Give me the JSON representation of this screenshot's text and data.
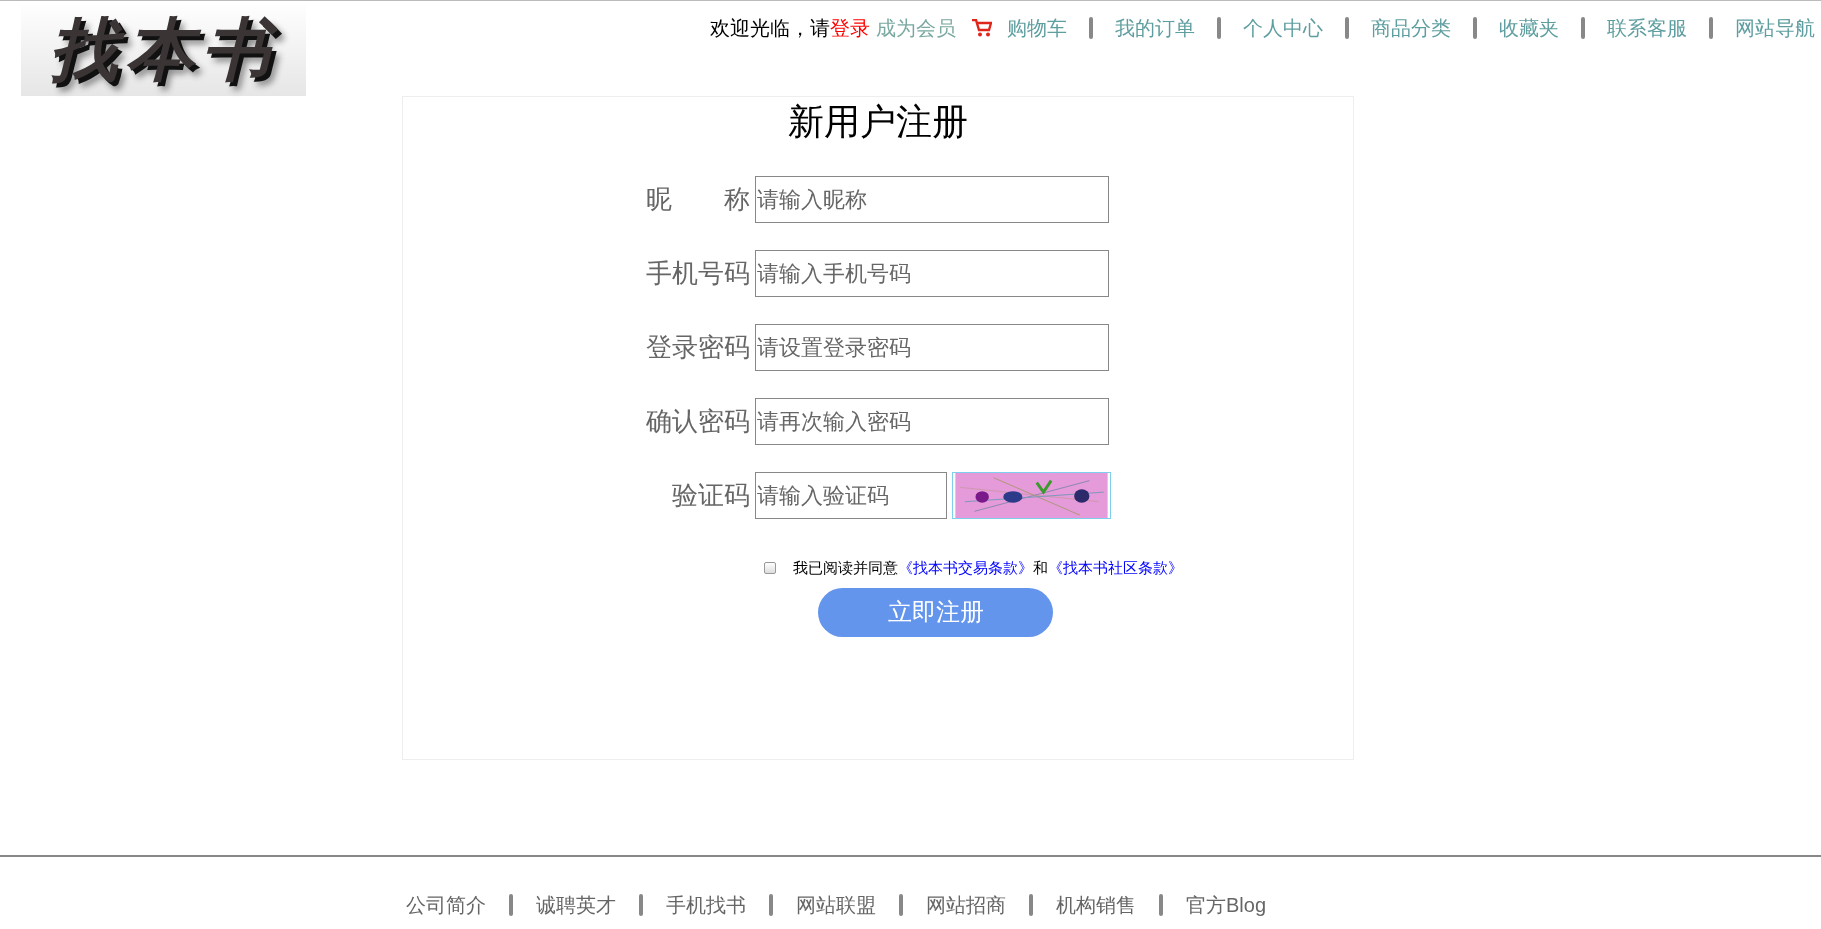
{
  "logo": {
    "text": "找本书"
  },
  "top_nav": {
    "welcome": "欢迎光临，请",
    "login": "登录",
    "register": "成为会员",
    "links": [
      {
        "label": "购物车",
        "kind": "cart"
      },
      {
        "label": "我的订单",
        "kind": "link"
      },
      {
        "label": "个人中心",
        "kind": "link"
      },
      {
        "label": "商品分类",
        "kind": "link"
      },
      {
        "label": "收藏夹",
        "kind": "link"
      },
      {
        "label": "联系客服",
        "kind": "link"
      },
      {
        "label": "网站导航",
        "kind": "link"
      }
    ]
  },
  "form": {
    "title": "新用户注册",
    "fields": [
      {
        "label": "昵　　称",
        "placeholder": "请输入昵称",
        "kind": "text"
      },
      {
        "label": "手机号码",
        "placeholder": "请输入手机号码",
        "kind": "text"
      },
      {
        "label": "登录密码",
        "placeholder": "请设置登录密码",
        "kind": "text"
      },
      {
        "label": "确认密码",
        "placeholder": "请再次输入密码",
        "kind": "text"
      },
      {
        "label": "验证码",
        "placeholder": "请输入验证码",
        "kind": "captcha"
      }
    ],
    "agreement": {
      "checked": false,
      "text": "我已阅读并同意",
      "terms_1": "《找本书交易条款》",
      "and": "和",
      "terms_2": "《找本书社区条款》"
    },
    "submit": "立即注册"
  },
  "footer": {
    "links": [
      "公司简介",
      "诚聘英才",
      "手机找书",
      "网站联盟",
      "网站招商",
      "机构销售",
      "官方Blog"
    ]
  }
}
